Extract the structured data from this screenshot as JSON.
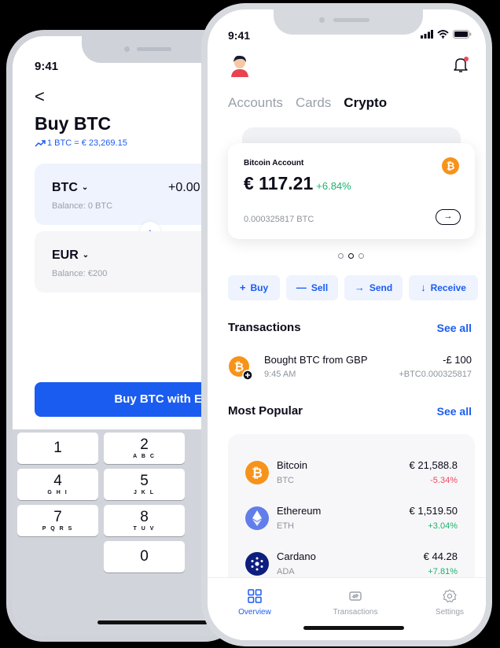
{
  "buy_screen": {
    "time": "9:41",
    "back": "<",
    "title": "Buy BTC",
    "rate": "1 BTC = € 23,269.15",
    "from": {
      "currency": "BTC",
      "balance": "Balance: 0 BTC",
      "amount": "+0.00"
    },
    "to": {
      "currency": "EUR",
      "balance": "Balance: €200"
    },
    "buy_button": "Buy BTC with EUR",
    "keys": [
      {
        "num": "1",
        "letters": ""
      },
      {
        "num": "2",
        "letters": "A B C"
      },
      {
        "num": "4",
        "letters": "G H I"
      },
      {
        "num": "5",
        "letters": "J K L"
      },
      {
        "num": "7",
        "letters": "P Q R S"
      },
      {
        "num": "8",
        "letters": "T U V"
      },
      {
        "num": "0",
        "letters": ""
      }
    ]
  },
  "crypto_screen": {
    "time": "9:41",
    "tabs": [
      "Accounts",
      "Cards",
      "Crypto"
    ],
    "card": {
      "label": "Bitcoin Account",
      "value": "€ 117.21",
      "change": "+6.84%",
      "btc_amount": "0.000325817 BTC"
    },
    "actions": [
      {
        "icon": "+",
        "label": "Buy"
      },
      {
        "icon": "—",
        "label": "Sell"
      },
      {
        "icon": "→",
        "label": "Send"
      },
      {
        "icon": "↓",
        "label": "Receive"
      }
    ],
    "transactions_title": "Transactions",
    "see_all": "See all",
    "transaction": {
      "name": "Bought BTC from GBP",
      "time": "9:45 AM",
      "amount": "-£ 100",
      "sub": "+BTC0.000325817"
    },
    "popular_title": "Most Popular",
    "popular_see_all": "See all",
    "coins": [
      {
        "name": "Bitcoin",
        "symbol": "BTC",
        "price": "€ 21,588.8",
        "change": "-5.34%"
      },
      {
        "name": "Ethereum",
        "symbol": "ETH",
        "price": "€ 1,519.50",
        "change": "+3.04%"
      },
      {
        "name": "Cardano",
        "symbol": "ADA",
        "price": "€ 44.28",
        "change": "+7.81%"
      }
    ],
    "nav": [
      "Overview",
      "Transactions",
      "Settings"
    ]
  },
  "colors": {
    "accent": "#1b5cf0",
    "positive": "#1db36b",
    "negative": "#ef4a5f",
    "bitcoin": "#f7931a"
  }
}
